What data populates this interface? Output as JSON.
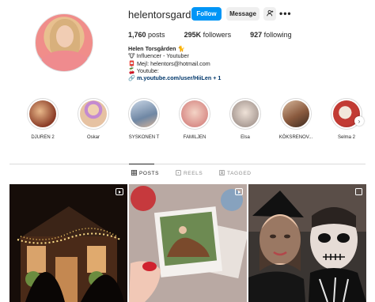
{
  "profile": {
    "username": "helentorsgarden",
    "follow_label": "Follow",
    "message_label": "Message",
    "suggest_icon": "add-person-icon",
    "more_icon": "more-options-icon",
    "posts_count": "1,760",
    "posts_label": "posts",
    "followers_count": "295K",
    "followers_label": "followers",
    "following_count": "927",
    "following_label": "following",
    "bio": {
      "name": "Helen Torsgården 🐈",
      "line1": "🐮 Influencer - Youtuber",
      "line2": "📮 Mejl: helentors@hotmail.com",
      "line3": "🍒 Youtube:",
      "link": "m.youtube.com/user/HiiLen + 1"
    }
  },
  "highlights": [
    {
      "label": "DJUREN 2",
      "color": "#b5553b"
    },
    {
      "label": "Oskar",
      "color": "#d9b48a"
    },
    {
      "label": "SYSKONEN T",
      "color": "#8aa0b8"
    },
    {
      "label": "FAMILJEN",
      "color": "#e2a7a0"
    },
    {
      "label": "Elsa",
      "color": "#c9b9ae"
    },
    {
      "label": "KÖKSRENOV...",
      "color": "#a86b4a"
    },
    {
      "label": "Selma 2",
      "color": "#c4453d"
    }
  ],
  "tabs": [
    {
      "label": "POSTS",
      "icon": "grid-icon"
    },
    {
      "label": "REELS",
      "icon": "reels-icon"
    },
    {
      "label": "TAGGED",
      "icon": "tagged-icon"
    }
  ],
  "colors": {
    "accent": "#0095f6",
    "text": "#262626",
    "muted": "#8e8e8e",
    "link": "#00376b"
  }
}
